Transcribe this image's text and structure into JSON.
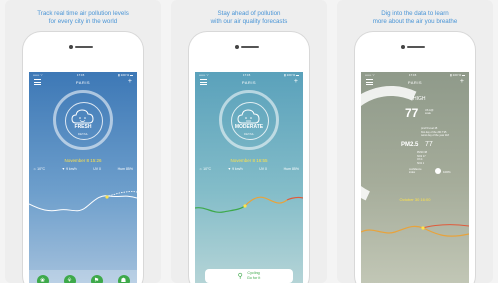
{
  "panels": [
    {
      "caption": "Track real time air pollution levels\nfor every city in the world",
      "city": "PARIS",
      "status_bar": {
        "carrier": "•••••• ⌔",
        "time": "17:15",
        "battery": "▮ 100 % ▬"
      },
      "gauge_label": "FRESH",
      "gauge_sub": "DETAIL",
      "date": "November 8 15:26",
      "stats": [
        "☼ 10°C",
        "▼ 9 km/h",
        "UV 0",
        "Hum 85%"
      ],
      "tabs": [
        "❀",
        "⚘",
        "⚑",
        "☗"
      ]
    },
    {
      "caption": "Stay ahead of pollution\nwith our air quality forecasts",
      "city": "PARIS",
      "status_bar": {
        "carrier": "•••••• ⌔",
        "time": "17:15",
        "battery": "▮ 100 % ▬"
      },
      "gauge_label": "MODERATE",
      "gauge_sub": "DETAIL",
      "date": "November 8 16:55",
      "stats": [
        "☼ 10°C",
        "▼ 9 km/h",
        "UV 0",
        "Hum 85%"
      ],
      "cta_line1": "Cycling",
      "cta_line2": "Go for it"
    },
    {
      "caption": "Dig into the data to learn\nmore about the air you breathe",
      "city": "PARIS",
      "status_bar": {
        "carrier": "•••••• ⌔",
        "time": "17:15",
        "battery": "▮ 100 % ▬"
      },
      "level": "HIGH",
      "aqi": "77",
      "aqi_unit": "US AQI\nscale",
      "details": [
        "pm2.5 level 45",
        "first day of the 2017 95",
        "worst day of the year 118"
      ],
      "pm_label": "PM2.5",
      "pm_value": "77",
      "pm_list": [
        "PM10 38",
        "NO2 17",
        "O3 4",
        "SO2 1"
      ],
      "confidence_label": "confidence\nindex",
      "confidence_value": "100%",
      "date": "October 30 16:00"
    }
  ],
  "colors": {
    "caption": "#4a95d6",
    "date_yellow": "#ffe34a",
    "action_green": "#3da94a",
    "curve_red": "#e05a3a",
    "curve_orange": "#e8a33c"
  },
  "icons": [
    "menu-icon",
    "plus-icon",
    "cloud-face-icon",
    "bicycle-icon",
    "flower-icon",
    "leaf-icon"
  ]
}
